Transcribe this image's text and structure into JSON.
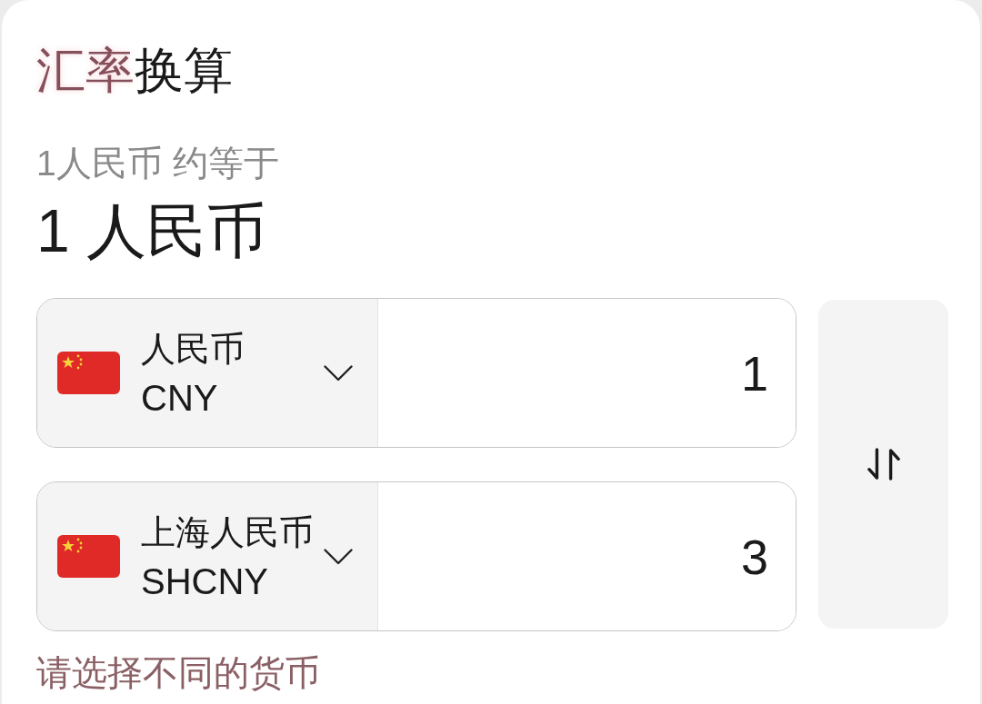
{
  "title": {
    "highlighted_text": "汇率",
    "rest_text": "换算"
  },
  "rate_caption": "1人民币 约等于",
  "rate_result": "1 人民币",
  "converters": [
    {
      "currency_name": "人民币",
      "currency_code": "CNY",
      "amount": "1"
    },
    {
      "currency_name": "上海人民币",
      "currency_code": "SHCNY",
      "amount": "3"
    }
  ],
  "error_message": "请选择不同的货币"
}
